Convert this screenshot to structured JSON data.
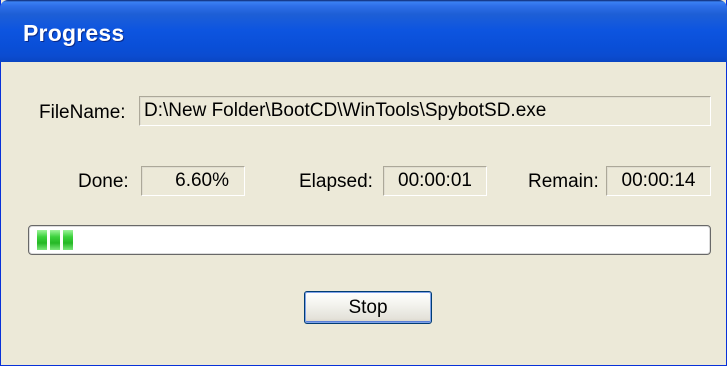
{
  "window": {
    "title": "Progress"
  },
  "fields": {
    "filename_label": "FileName:",
    "filename_value": "D:\\New Folder\\BootCD\\WinTools\\SpybotSD.exe",
    "done_label": "Done:",
    "done_value": "6.60%",
    "elapsed_label": "Elapsed:",
    "elapsed_value": "00:00:01",
    "remain_label": "Remain:",
    "remain_value": "00:00:14"
  },
  "progress": {
    "fraction": 0.066,
    "color": "#26b826"
  },
  "buttons": {
    "stop_label": "Stop"
  },
  "colors": {
    "titlebar": "#0a4fd8",
    "dialog_bg": "#ece9d8",
    "button_border": "#003c74"
  }
}
